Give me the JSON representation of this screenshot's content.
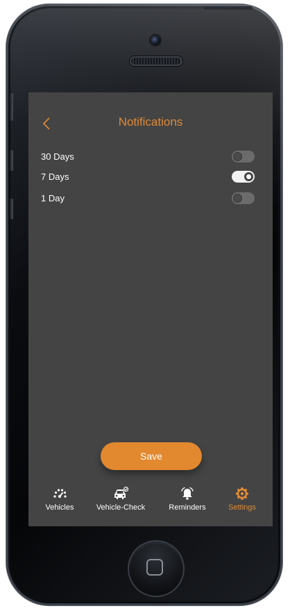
{
  "colors": {
    "accent": "#e08a36",
    "screen_background": "#444444",
    "text": "#ffffff"
  },
  "header": {
    "back_icon": "chevron-left-icon",
    "title": "Notifications"
  },
  "notification_options": [
    {
      "label": "30 Days",
      "enabled": false
    },
    {
      "label": "7 Days",
      "enabled": true
    },
    {
      "label": "1 Day",
      "enabled": false
    }
  ],
  "save_button": {
    "label": "Save"
  },
  "tabbar": {
    "tabs": [
      {
        "label": "Vehicles",
        "icon": "speedometer-icon",
        "active": false
      },
      {
        "label": "Vehicle-Check",
        "icon": "car-check-icon",
        "active": false
      },
      {
        "label": "Reminders",
        "icon": "alarm-bell-icon",
        "active": false
      },
      {
        "label": "Settings",
        "icon": "gear-icon",
        "active": true
      }
    ]
  }
}
